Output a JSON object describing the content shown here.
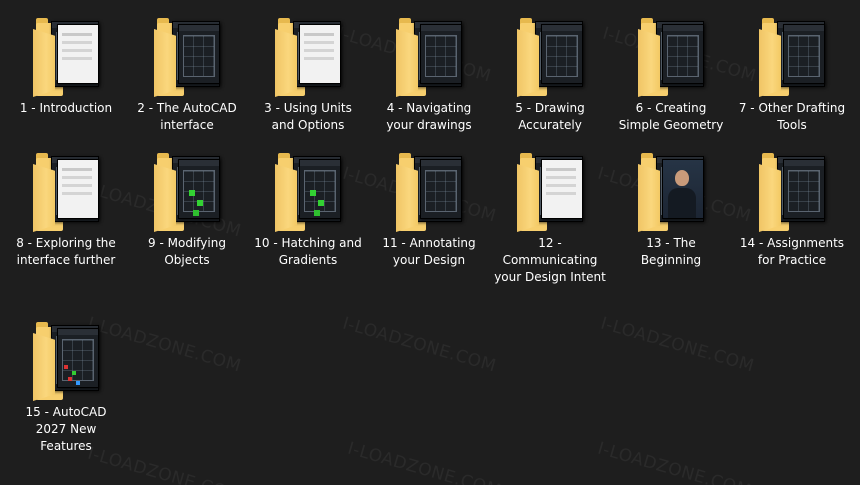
{
  "folders": [
    {
      "label": "1 - Introduction",
      "thumb": "light"
    },
    {
      "label": "2 - The AutoCAD interface",
      "thumb": "cad"
    },
    {
      "label": "3 - Using Units and Options",
      "thumb": "light"
    },
    {
      "label": "4 - Navigating your drawings",
      "thumb": "cad"
    },
    {
      "label": "5 - Drawing Accurately",
      "thumb": "cad"
    },
    {
      "label": "6 - Creating Simple Geometry",
      "thumb": "cad"
    },
    {
      "label": "7 - Other Drafting Tools",
      "thumb": "cad"
    },
    {
      "label": "8 - Exploring the interface further",
      "thumb": "light"
    },
    {
      "label": "9 - Modifying Objects",
      "thumb": "cad-green"
    },
    {
      "label": "10 - Hatching and Gradients",
      "thumb": "cad-green"
    },
    {
      "label": "11 - Annotating your Design",
      "thumb": "cad"
    },
    {
      "label": "12 - Communicating your Design Intent",
      "thumb": "light"
    },
    {
      "label": "13 - The Beginning",
      "thumb": "person"
    },
    {
      "label": "14 - Assignments for Practice",
      "thumb": "cad"
    },
    {
      "label": "15 - AutoCAD 2027 New Features",
      "thumb": "cad-red"
    }
  ],
  "watermark": "I-LOADZONE.COM"
}
